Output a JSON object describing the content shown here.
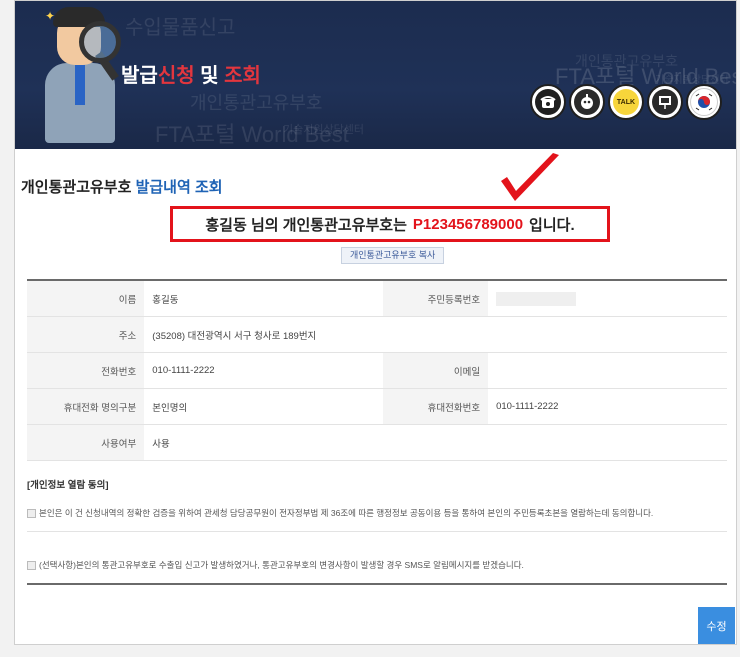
{
  "banner": {
    "title_part1": "발급",
    "title_part2": "신청",
    "title_part3": " 및 ",
    "title_part4": "조회",
    "watermarks": [
      "수입물품신고",
      "개인통관고유부호",
      "개인통관고유부호",
      "FTA포털 World Best",
      "FTA포털 World Best",
      "기술지원상담센터",
      "기술지원상담센터"
    ],
    "icons": [
      "phone-icon",
      "robot-icon",
      "talk-icon",
      "presentation-icon",
      "taegeuk-icon"
    ],
    "talk_label": "TALK"
  },
  "heading": {
    "black": "개인통관고유부호 ",
    "blue": "발급내역 조회"
  },
  "highlight": {
    "prefix": "홍길동 님의 개인통관고유부호는 ",
    "number": "P123456789000",
    "suffix": "입니다."
  },
  "copy_button": "개인통관고유부호 복사",
  "info": {
    "name_label": "이름",
    "name_value": "홍길동",
    "rrn_label": "주민등록번호",
    "address_label": "주소",
    "address_value": "(35208)  대전광역시 서구 청사로 189번지",
    "phone_label": "전화번호",
    "phone_value": "010-1111-2222",
    "email_label": "이메일",
    "mobile_owner_label": "휴대전화 명의구분",
    "mobile_owner_value": "본인명의",
    "mobile_label": "휴대전화번호",
    "mobile_value": "010-1111-2222",
    "use_label": "사용여부",
    "use_value": "사용"
  },
  "consent": {
    "title": "[개인정보 열람 동의]",
    "item1": "본인은 이 건 신청내역의 정확한 검증을 위하여 관세청 담당공무원이 전자정부법 제 36조에 따른 행정정보 공동이용 등을 통하여 본인의 주민등록초본을 열람하는데 동의합니다.",
    "item2": "(선택사항)본인의 통관고유부호로 수출입 신고가 발생하였거나, 통관고유부호의 변경사항이 발생할 경우 SMS로 알림메시지를 받겠습니다."
  },
  "edit_button": "수정",
  "colors": {
    "banner_bg": "#1f3157",
    "accent_red": "#e3131b",
    "heading_blue": "#1f63b5",
    "button_blue": "#3a8ee0"
  }
}
